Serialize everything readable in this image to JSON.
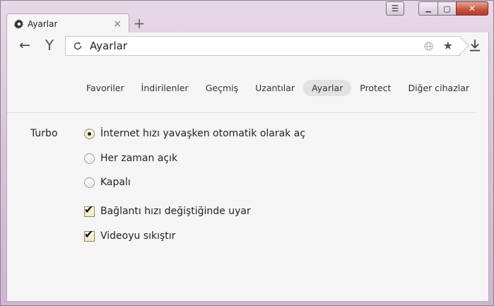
{
  "window": {
    "controls": {
      "menu_glyph": "☰",
      "minimize_glyph": "▁",
      "maximize_glyph": "▢",
      "close_glyph": "✕"
    }
  },
  "tab": {
    "title": "Ayarlar",
    "icon": "gear-icon",
    "close_glyph": "×"
  },
  "new_tab_glyph": "+",
  "toolbar": {
    "back_glyph": "←",
    "logo_glyph": "Y",
    "address": "Ayarlar",
    "star_glyph": "★"
  },
  "settings": {
    "nav": [
      {
        "label": "Favoriler",
        "active": false
      },
      {
        "label": "İndirilenler",
        "active": false
      },
      {
        "label": "Geçmiş",
        "active": false
      },
      {
        "label": "Uzantılar",
        "active": false
      },
      {
        "label": "Ayarlar",
        "active": true
      },
      {
        "label": "Protect",
        "active": false
      },
      {
        "label": "Diğer cihazlar",
        "active": false
      }
    ],
    "turbo": {
      "label": "Turbo",
      "radios": [
        {
          "label": "İnternet hızı yavaşken otomatik olarak aç",
          "selected": true
        },
        {
          "label": "Her zaman açık",
          "selected": false
        },
        {
          "label": "Kapalı",
          "selected": false
        }
      ],
      "checkboxes": [
        {
          "label": "Bağlantı hızı değiştiğinde uyar",
          "checked": true
        },
        {
          "label": "Videoyu sıkıştır",
          "checked": true
        }
      ],
      "check_glyph": "✔"
    }
  }
}
